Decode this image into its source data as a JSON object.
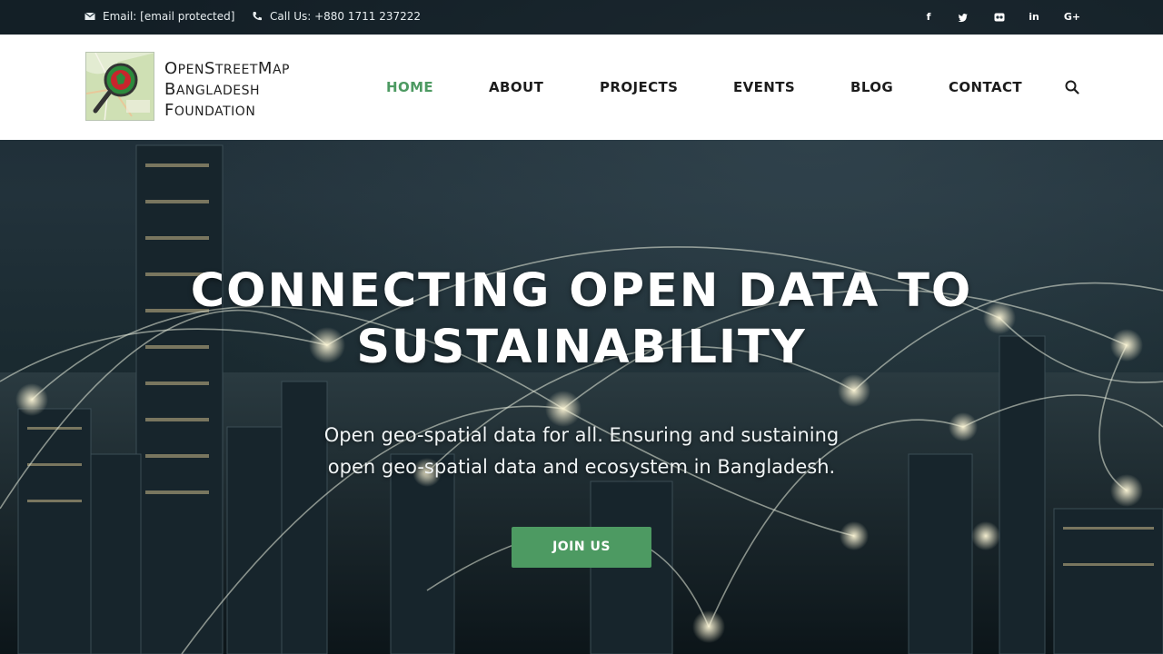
{
  "topbar": {
    "email_label": "Email: [email protected]",
    "phone_label": "Call Us: +880 1711 237222",
    "social": [
      {
        "name": "facebook-icon",
        "glyph": "f"
      },
      {
        "name": "twitter-icon",
        "glyph": "t"
      },
      {
        "name": "flickr-icon",
        "glyph": "••"
      },
      {
        "name": "linkedin-icon",
        "glyph": "in"
      },
      {
        "name": "google-plus-icon",
        "glyph": "G+"
      }
    ]
  },
  "logo": {
    "line1_first": "O",
    "line1_rest": "PEN",
    "line1_first2": "S",
    "line1_rest2": "TREET",
    "line1_first3": "M",
    "line1_rest3": "AP",
    "line2_first": "B",
    "line2_rest": "ANGLADESH",
    "line3_first": "F",
    "line3_rest": "OUNDATION"
  },
  "nav": {
    "home": "HOME",
    "about": "ABOUT",
    "projects": "PROJECTS",
    "events": "EVENTS",
    "blog": "BLOG",
    "contact": "CONTACT"
  },
  "hero": {
    "title_line1": "CONNECTING OPEN DATA TO",
    "title_line2": "SUSTAINABILITY",
    "subtitle_line1": "Open geo-spatial data for all. Ensuring and sustaining",
    "subtitle_line2": "open geo-spatial data and ecosystem in Bangladesh.",
    "cta_label": "JOIN US"
  },
  "colors": {
    "accent": "#4d9a62",
    "nav_text": "#1c1c1c",
    "header_bg": "#ffffff"
  }
}
